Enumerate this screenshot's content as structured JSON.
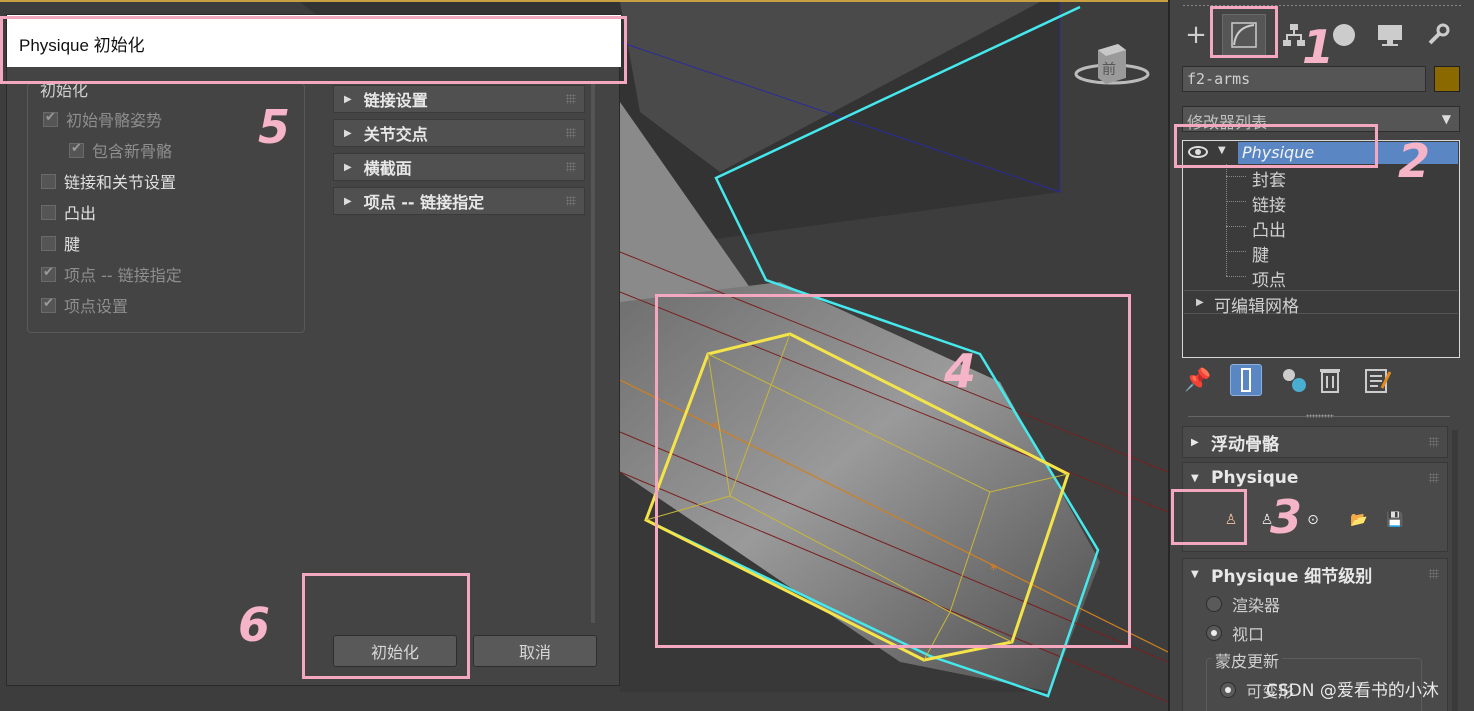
{
  "dialog": {
    "title": "Physique 初始化",
    "init_group": {
      "title": "初始化",
      "options": [
        {
          "label": "初始骨骼姿势",
          "checked": true,
          "enabled": false
        },
        {
          "label": "包含新骨骼",
          "checked": true,
          "enabled": false
        },
        {
          "label": "链接和关节设置",
          "checked": false,
          "enabled": true
        },
        {
          "label": "凸出",
          "checked": false,
          "enabled": true
        },
        {
          "label": "腱",
          "checked": false,
          "enabled": true
        },
        {
          "label": "项点 -- 链接指定",
          "checked": true,
          "enabled": false
        },
        {
          "label": "项点设置",
          "checked": true,
          "enabled": false
        }
      ]
    },
    "rollouts": [
      "链接设置",
      "关节交点",
      "横截面",
      "项点 -- 链接指定"
    ],
    "init_button": "初始化",
    "cancel_button": "取消"
  },
  "viewport": {
    "viewcube_label": "前"
  },
  "command_panel": {
    "object_name": "f2-arms",
    "object_color": "#8a6a00",
    "modifier_list_label": "修改器列表",
    "stack": {
      "selected": "Physique",
      "sub_objects": [
        "封套",
        "链接",
        "凸出",
        "腱",
        "项点"
      ],
      "base": "可编辑网格"
    },
    "rollouts": {
      "floating_bones": "浮动骨骼",
      "physique": "Physique",
      "lod": "Physique 细节级别"
    },
    "lod": {
      "renderer": "渲染器",
      "viewport": "视口",
      "skin_update_title": "蒙皮更新",
      "deformable": "可变形"
    }
  },
  "annotations": [
    "1",
    "2",
    "3",
    "4",
    "5",
    "6"
  ],
  "watermark": "CSDN @爱看书的小沐"
}
